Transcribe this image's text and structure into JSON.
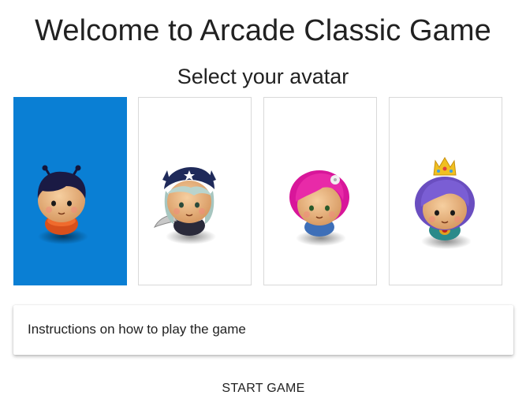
{
  "header": {
    "title": "Welcome to Arcade Classic Game",
    "subtitle": "Select your avatar"
  },
  "avatars": {
    "selected_index": 0,
    "items": [
      {
        "icon": "boy-antennae-avatar-icon",
        "selected": true
      },
      {
        "icon": "pirate-girl-avatar-icon",
        "selected": false
      },
      {
        "icon": "pink-hair-girl-avatar-icon",
        "selected": false
      },
      {
        "icon": "princess-avatar-icon",
        "selected": false
      }
    ]
  },
  "instructions": {
    "label": "Instructions on how to play the game"
  },
  "actions": {
    "start_label": "START GAME"
  },
  "colors": {
    "selected_card": "#0a7fd4",
    "card_border": "#d9d9d9"
  }
}
